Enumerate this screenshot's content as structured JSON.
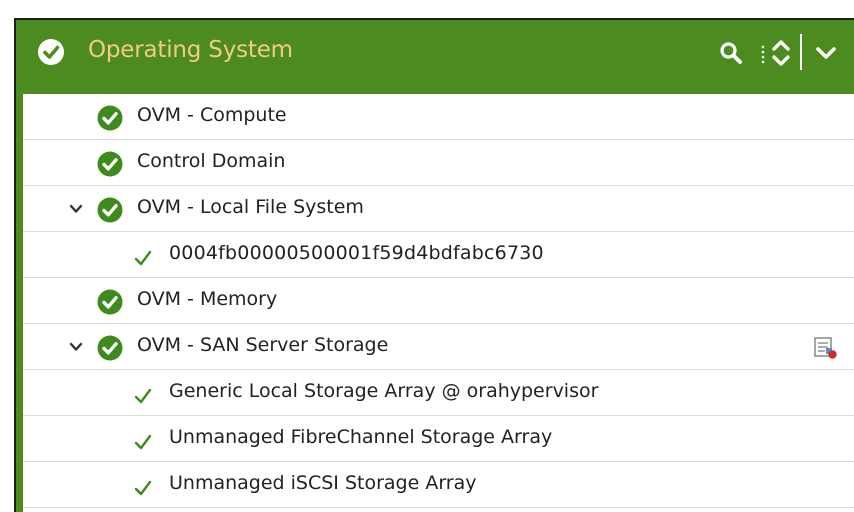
{
  "panel": {
    "title": "Operating System",
    "status_icon": "check-circle-icon",
    "header_color": "#4c8b1f",
    "title_color": "#f3c98a"
  },
  "toolbar": {
    "search_icon": "search-icon",
    "sort_icon": "sort-updown-icon",
    "collapse_icon": "chevron-down-icon"
  },
  "rows": [
    {
      "label": "OVM - Compute",
      "level": 0,
      "icon": "check-circle-icon"
    },
    {
      "label": "Control Domain",
      "level": 0,
      "icon": "check-circle-icon"
    },
    {
      "label": "OVM - Local File System",
      "level": 0,
      "icon": "check-circle-icon",
      "expanded": true
    },
    {
      "label": "0004fb00000500001f59d4bdfabc6730",
      "level": 1,
      "icon": "checkmark-icon"
    },
    {
      "label": "OVM - Memory",
      "level": 0,
      "icon": "check-circle-icon"
    },
    {
      "label": "OVM - SAN Server Storage",
      "level": 0,
      "icon": "check-circle-icon",
      "expanded": true,
      "action_icon": "report-alert-icon"
    },
    {
      "label": "Generic Local Storage Array @ orahypervisor",
      "level": 1,
      "icon": "checkmark-icon"
    },
    {
      "label": "Unmanaged FibreChannel Storage Array",
      "level": 1,
      "icon": "checkmark-icon"
    },
    {
      "label": "Unmanaged iSCSI Storage Array",
      "level": 1,
      "icon": "checkmark-icon"
    }
  ]
}
